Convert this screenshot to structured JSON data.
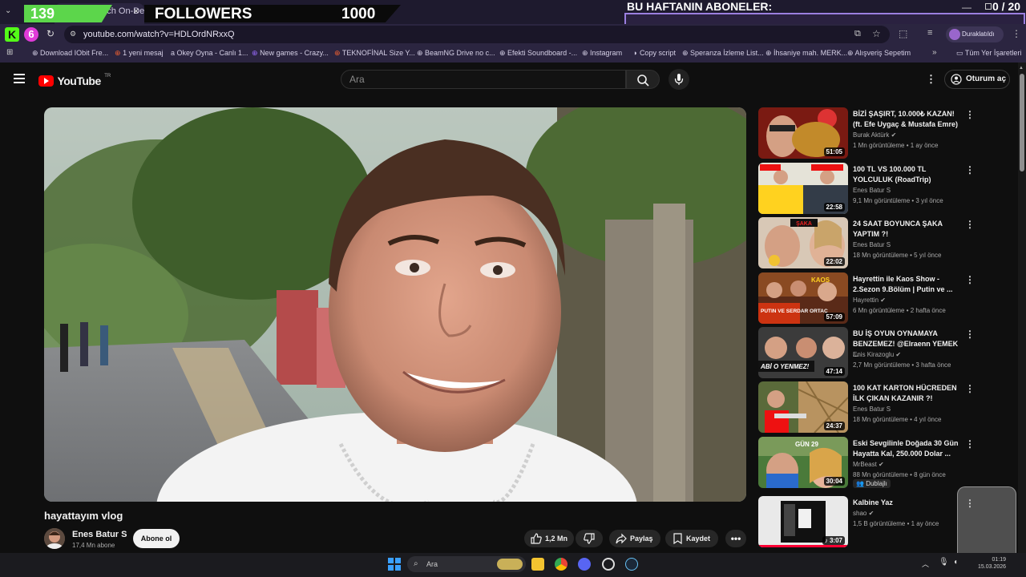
{
  "browser": {
    "tab_title": "ideos - Watch On-Der",
    "tab_close": "×",
    "new_tab": "+",
    "url": "youtube.com/watch?v=HDLOrdNRxxQ",
    "paused_label": "Duraklatıldı",
    "bookmarks": [
      "Download IObit Fre...",
      "1 yeni mesaj",
      "Okey Oyna - Canlı 1...",
      "New games - Crazy...",
      "TEKNOFİNAL Size Y...",
      "BeamNG Drive no c...",
      "Efekti Soundboard -...",
      "Instagram",
      "Copy script",
      "Speranza İzleme List...",
      "İhsaniye mah. MERK...",
      "Alışveriş Sepetim"
    ],
    "more_bookmarks": "»",
    "all_bookmarks": "Tüm Yer İşaretleri"
  },
  "overlay": {
    "counter": "139",
    "followers_label": "FOLLOWERS",
    "followers_count": "1000",
    "subs_title": "BU HAFTANIN ABONELER:",
    "subs_count": "0 / 20",
    "subs_progress": 0,
    "accent": "#5cd64b",
    "frame_color": "#9b7fe0"
  },
  "youtube": {
    "logo": "YouTube",
    "region": "TR",
    "search_placeholder": "Ara",
    "signin": "Oturum aç"
  },
  "video": {
    "title": "hayattayım vlog",
    "channel": "Enes Batur S",
    "subscribers": "17,4 Mn abone",
    "subscribe": "Abone ol",
    "likes": "1,2 Mn",
    "share": "Paylaş",
    "save": "Kaydet"
  },
  "recommendations": [
    {
      "title": "BİZİ ŞAŞIRT, 10.000₺ KAZAN! (ft. Efe Uygaç & Mustafa Emre)",
      "channel": "Burak Aktürk",
      "verified": true,
      "meta": "1 Mn görüntüleme • 1 ay önce",
      "duration": "51:05",
      "badge": ""
    },
    {
      "title": "100 TL VS 100.000 TL YOLCULUK (RoadTrip)",
      "channel": "Enes Batur S",
      "verified": false,
      "meta": "9,1 Mn görüntüleme • 3 yıl önce",
      "duration": "22:58",
      "badge": ""
    },
    {
      "title": "24 SAAT BOYUNCA ŞAKA YAPTIM ?!",
      "channel": "Enes Batur S",
      "verified": false,
      "meta": "18 Mn görüntüleme • 5 yıl önce",
      "duration": "22:02",
      "badge": ""
    },
    {
      "title": "Hayrettin ile Kaos Show - 2.Sezon 9.Bölüm | Putin ve ...",
      "channel": "Hayrettin",
      "verified": true,
      "meta": "6 Mn görüntüleme • 2 hafta önce",
      "duration": "57:09",
      "badge": ""
    },
    {
      "title": "BU İŞ OYUN OYNAMAYA BENZEMEZ! @Elraenn YEMEK ...",
      "channel": "Enis Kirazoglu",
      "verified": true,
      "meta": "2,7 Mn görüntüleme • 3 hafta önce",
      "duration": "47:14",
      "badge": ""
    },
    {
      "title": "100 KAT KARTON HÜCREDEN İLK ÇIKAN KAZANIR ?!",
      "channel": "Enes Batur S",
      "verified": false,
      "meta": "18 Mn görüntüleme • 4 yıl önce",
      "duration": "24:37",
      "badge": ""
    },
    {
      "title": "Eski Sevgilinle Doğada 30 Gün Hayatta Kal, 250.000 Dolar ...",
      "channel": "MrBeast",
      "verified": true,
      "meta": "88 Mn görüntüleme • 8 gün önce",
      "duration": "30:04",
      "badge": "Dublajlı"
    },
    {
      "title": "Kalbine Yaz",
      "channel": "shao",
      "verified": true,
      "meta": "1,5 B görüntüleme • 1 ay önce",
      "duration": "3:07",
      "badge": ""
    }
  ],
  "thumb_texts": {
    "t3": "ŞAKA",
    "t4a": "KAOS",
    "t4b": "PUTIN VE SERDAR ORTAÇ",
    "t5": "ABİ O YENMEZ!",
    "t7": "GÜN 29"
  },
  "taskbar": {
    "search": "Ara",
    "time": "01:19",
    "date": "15.03.2026"
  }
}
